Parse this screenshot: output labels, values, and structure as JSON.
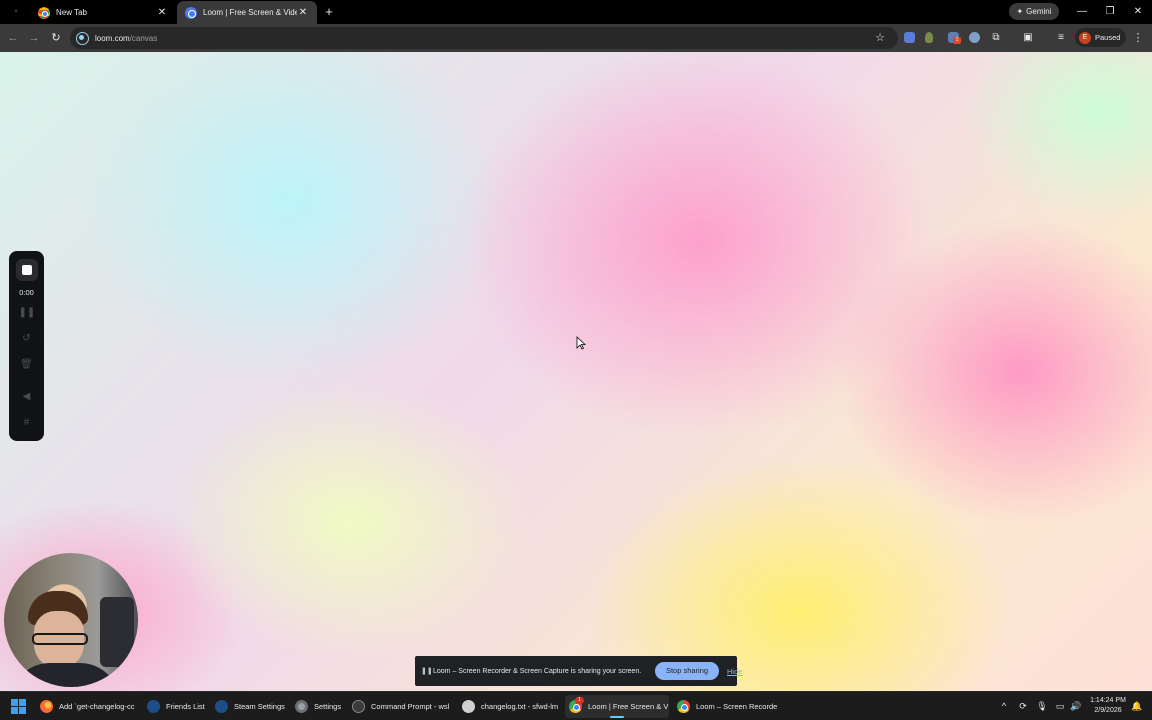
{
  "browser": {
    "tabs": [
      {
        "title": "New Tab",
        "active": false
      },
      {
        "title": "Loom | Free Screen & Video Recording",
        "active": true
      }
    ],
    "gemini_label": "Gemini",
    "url_domain": "loom.com",
    "url_path": "/canvas",
    "profile_initial": "E",
    "profile_status": "Paused",
    "extension_badge": "1"
  },
  "recorder": {
    "timer": "0:00"
  },
  "share_bar": {
    "message": "Loom – Screen Recorder & Screen Capture is sharing your screen.",
    "stop_label": "Stop sharing",
    "hide_label": "Hide"
  },
  "taskbar": {
    "items": [
      {
        "label": "Add `get-changelog-cc",
        "icon": "firefox-icon"
      },
      {
        "label": "Friends List",
        "icon": "steam-icon"
      },
      {
        "label": "Steam Settings",
        "icon": "steam-icon"
      },
      {
        "label": "Settings",
        "icon": "settings-gear-icon"
      },
      {
        "label": "Command Prompt - wsl",
        "icon": "terminal-icon"
      },
      {
        "label": "changelog.txt - sfwd-lm",
        "icon": "notepad-icon"
      },
      {
        "label": "Loom | Free Screen & V",
        "icon": "chrome-icon"
      },
      {
        "label": "Loom – Screen Recorde",
        "icon": "chrome-icon"
      }
    ],
    "chrome_badge": "1",
    "time": "1:14:24 PM",
    "date": "2/9/2026"
  },
  "colors": {
    "accent_blue": "#8ab4f8",
    "taskbar_active": "#60cdff",
    "profile_red": "#c9401e"
  }
}
